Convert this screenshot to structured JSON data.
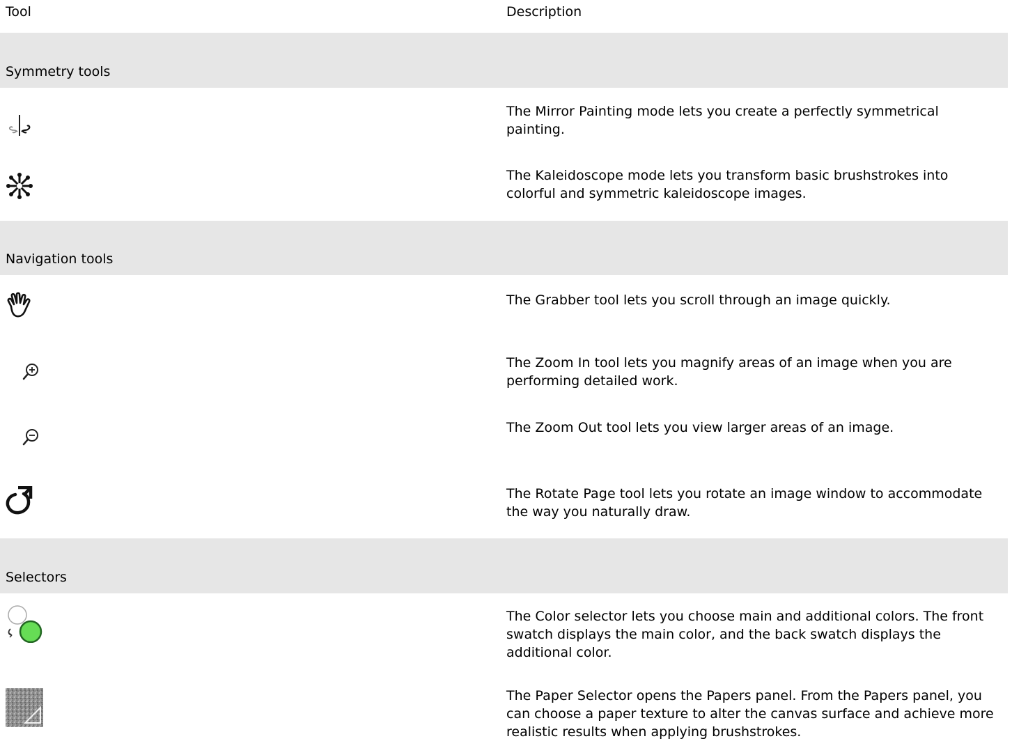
{
  "header": {
    "tool_label": "Tool",
    "description_label": "Description"
  },
  "sections": [
    {
      "title": "Symmetry tools",
      "rows": [
        {
          "icon": "mirror-painting-icon",
          "parts": [
            {
              "t": "The ",
              "k": false
            },
            {
              "t": "Mirror Painting",
              "k": true
            },
            {
              "t": " mode lets you create a perfectly symmetrical painting.",
              "k": false
            }
          ]
        },
        {
          "icon": "kaleidoscope-icon",
          "parts": [
            {
              "t": "The ",
              "k": false
            },
            {
              "t": "Kaleidoscope",
              "k": true
            },
            {
              "t": " mode lets you transform basic brushstrokes into colorful and symmetric kaleidoscope images.",
              "k": false
            }
          ]
        }
      ]
    },
    {
      "title": "Navigation tools",
      "rows": [
        {
          "icon": "grabber-hand-icon",
          "parts": [
            {
              "t": "The ",
              "k": false
            },
            {
              "t": "Grabber",
              "k": true
            },
            {
              "t": " tool lets you scroll through an image quickly.",
              "k": false
            }
          ]
        },
        {
          "icon": "zoom-in-icon",
          "parts": [
            {
              "t": "The ",
              "k": false
            },
            {
              "t": "Zoom In",
              "k": true
            },
            {
              "t": " tool lets you magnify areas of an image when you are performing detailed work.",
              "k": false
            }
          ]
        },
        {
          "icon": "zoom-out-icon",
          "parts": [
            {
              "t": "The ",
              "k": false
            },
            {
              "t": "Zoom Out",
              "k": true
            },
            {
              "t": " tool lets you view larger areas of an image.",
              "k": false
            }
          ]
        },
        {
          "icon": "rotate-page-icon",
          "parts": [
            {
              "t": "The ",
              "k": false
            },
            {
              "t": "Rotate Page",
              "k": true
            },
            {
              "t": " tool lets you rotate an image window to accommodate the way you naturally draw.",
              "k": false
            }
          ]
        }
      ]
    },
    {
      "title": "Selectors",
      "rows": [
        {
          "icon": "color-selector-icon",
          "parts": [
            {
              "t": "The ",
              "k": false
            },
            {
              "t": "Color",
              "k": true
            },
            {
              "t": " selector lets you choose main and additional colors. The front swatch displays the main color, and the back swatch displays the additional color.",
              "k": false
            }
          ]
        },
        {
          "icon": "paper-selector-icon",
          "parts": [
            {
              "t": "The ",
              "k": false
            },
            {
              "t": "Paper Selector",
              "k": true
            },
            {
              "t": " opens the ",
              "k": false
            },
            {
              "t": "Papers",
              "k": true
            },
            {
              "t": " panel. From the ",
              "k": false
            },
            {
              "t": "Papers",
              "k": true
            },
            {
              "t": " panel, you can choose a paper texture to alter the canvas surface and achieve more realistic results when applying brushstrokes.",
              "k": false
            }
          ]
        }
      ]
    }
  ],
  "colors": {
    "section_band": "#e6e6e6",
    "main_color_swatch": "#66dd55",
    "text": "#000000"
  }
}
